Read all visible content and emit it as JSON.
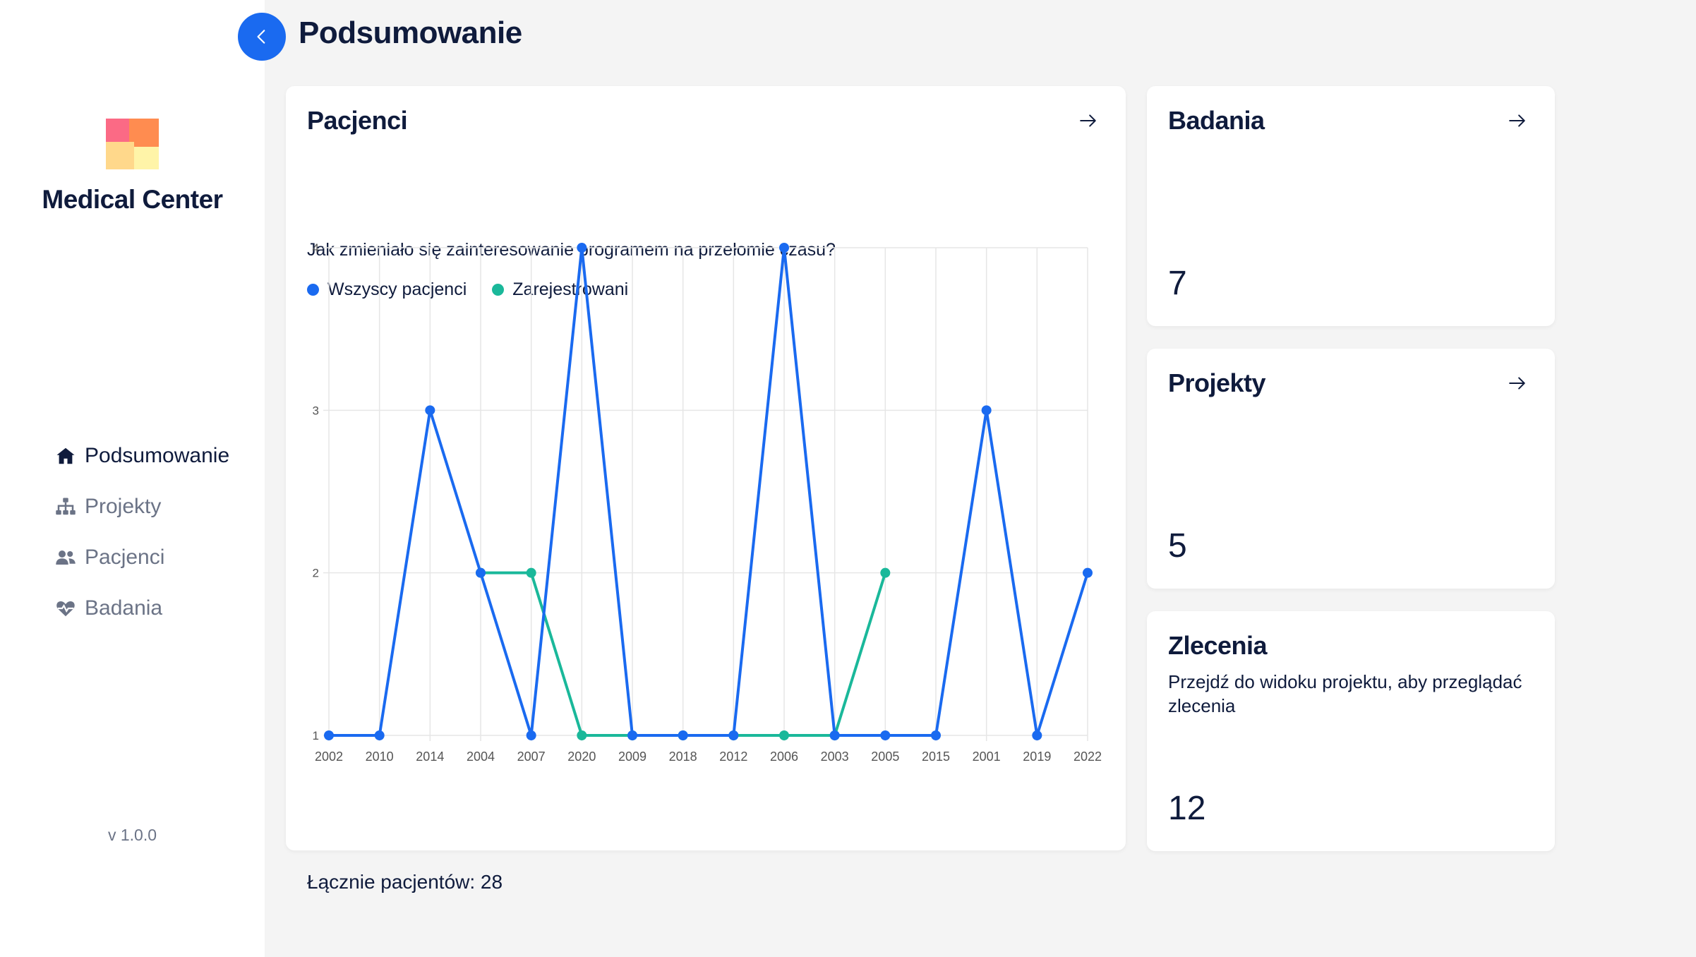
{
  "app": {
    "brand": "Medical Center",
    "version": "v 1.0.0"
  },
  "sidebar": {
    "items": [
      {
        "label": "Podsumowanie",
        "icon": "home-icon",
        "active": true
      },
      {
        "label": "Projekty",
        "icon": "sitemap-icon",
        "active": false
      },
      {
        "label": "Pacjenci",
        "icon": "users-icon",
        "active": false
      },
      {
        "label": "Badania",
        "icon": "heart-pulse-icon",
        "active": false
      }
    ]
  },
  "header": {
    "title": "Podsumowanie",
    "back_icon": "chevron-left-icon"
  },
  "colors": {
    "accent": "#1a6af0",
    "series_all": "#1a6af0",
    "series_registered": "#1ab89a"
  },
  "patients_card": {
    "title": "Pacjenci",
    "question": "Jak zmieniało się zainteresowanie programem na przełomie czasu?",
    "legend": [
      "Wszyscy pacjenci",
      "Zarejestrowani"
    ],
    "total": "Łącznie pacjentów: 28"
  },
  "chart_data": {
    "type": "line",
    "categories": [
      "2002",
      "2010",
      "2014",
      "2004",
      "2007",
      "2020",
      "2009",
      "2018",
      "2012",
      "2006",
      "2003",
      "2005",
      "2015",
      "2001",
      "2019",
      "2022"
    ],
    "series": [
      {
        "name": "Wszyscy pacjenci",
        "color": "#1a6af0",
        "values": [
          1,
          1,
          3,
          2,
          1,
          4,
          1,
          1,
          1,
          4,
          1,
          1,
          1,
          3,
          1,
          2
        ]
      },
      {
        "name": "Zarejestrowani",
        "color": "#1ab89a",
        "values": [
          null,
          null,
          null,
          2,
          2,
          1,
          1,
          1,
          1,
          1,
          1,
          2,
          null,
          null,
          null,
          null
        ]
      }
    ],
    "yticks": [
      "1",
      "2",
      "3",
      "4"
    ],
    "ylim": [
      1,
      4
    ],
    "grid": true,
    "legend_position": "top-left"
  },
  "cards": {
    "badania": {
      "title": "Badania",
      "value": "7"
    },
    "projekty": {
      "title": "Projekty",
      "value": "5"
    },
    "zlecenia": {
      "title": "Zlecenia",
      "description": "Przejdź do widoku projektu, aby przeglądać zlecenia",
      "value": "12"
    }
  }
}
